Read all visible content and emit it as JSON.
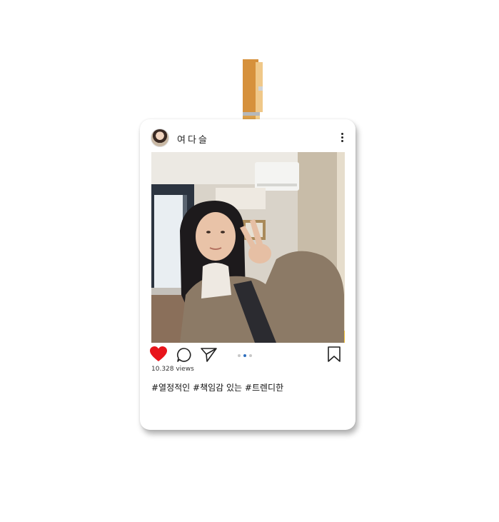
{
  "post": {
    "username": "여다슬",
    "views": "10.328 views",
    "caption": "#열정적인 #책임감 있는 #트렌디한",
    "carousel": {
      "total": 3,
      "active_index": 1
    },
    "liked": true
  },
  "icons": {
    "avatar": "profile-avatar",
    "more": "more-vertical-icon",
    "like": "heart-icon",
    "comment": "comment-icon",
    "share": "send-icon",
    "save": "bookmark-icon",
    "clip": "clothespin-icon"
  },
  "colors": {
    "heart": "#e8141b",
    "carousel_active": "#2f6fbe",
    "clothespin": "#d4943f"
  }
}
